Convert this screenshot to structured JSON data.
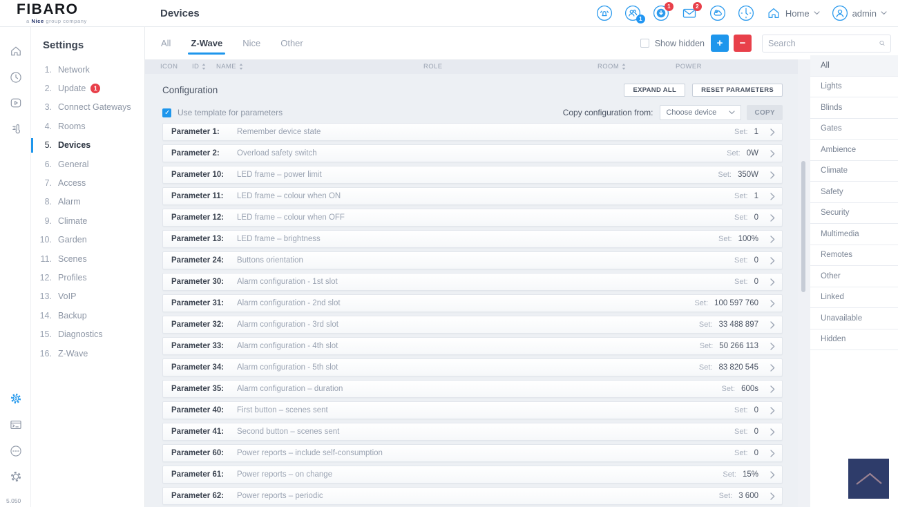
{
  "app": {
    "version": "5.050"
  },
  "colors": {
    "accent_blue": "#1e96ec",
    "danger_red": "#e8404a",
    "navy_button": "#2e3c6a",
    "active_tab_underline": "#1e96ec"
  },
  "logo": {
    "brand": "FIBARO",
    "tagline_prefix": "a ",
    "tagline_brand": "Nice",
    "tagline_suffix": " group company"
  },
  "header": {
    "title": "Devices",
    "notifications": {
      "users_badge": "1",
      "update_badge": "1",
      "messages_badge": "2"
    },
    "home": {
      "label": "Home"
    },
    "user": {
      "label": "admin"
    }
  },
  "sidebar": {
    "title": "Settings",
    "items": [
      {
        "num": "1.",
        "label": "Network"
      },
      {
        "num": "2.",
        "label": "Update",
        "badge": "1"
      },
      {
        "num": "3.",
        "label": "Connect Gateways"
      },
      {
        "num": "4.",
        "label": "Rooms"
      },
      {
        "num": "5.",
        "label": "Devices",
        "active": true
      },
      {
        "num": "6.",
        "label": "General"
      },
      {
        "num": "7.",
        "label": "Access"
      },
      {
        "num": "8.",
        "label": "Alarm"
      },
      {
        "num": "9.",
        "label": "Climate"
      },
      {
        "num": "10.",
        "label": "Garden"
      },
      {
        "num": "11.",
        "label": "Scenes"
      },
      {
        "num": "12.",
        "label": "Profiles"
      },
      {
        "num": "13.",
        "label": "VoIP"
      },
      {
        "num": "14.",
        "label": "Backup"
      },
      {
        "num": "15.",
        "label": "Diagnostics"
      },
      {
        "num": "16.",
        "label": "Z-Wave"
      }
    ]
  },
  "tabs": [
    {
      "label": "All"
    },
    {
      "label": "Z-Wave",
      "active": true
    },
    {
      "label": "Nice"
    },
    {
      "label": "Other"
    }
  ],
  "toolbar": {
    "show_hidden_label": "Show hidden",
    "add_label": "+",
    "remove_label": "−",
    "search_placeholder": "Search"
  },
  "table_header": [
    {
      "label": "ICON"
    },
    {
      "label": "ID",
      "sortable": true
    },
    {
      "label": "NAME",
      "sortable": true
    },
    {
      "label": "ROLE"
    },
    {
      "label": "ROOM",
      "sortable": true
    },
    {
      "label": "POWER"
    }
  ],
  "configuration": {
    "title": "Configuration",
    "expand_all_label": "EXPAND ALL",
    "reset_label": "RESET PARAMETERS",
    "use_template_label": "Use template for parameters",
    "copy_from_label": "Copy configuration from:",
    "choose_device_label": "Choose device",
    "copy_label": "COPY",
    "set_label": "Set:",
    "parameters": [
      {
        "name": "Parameter 1:",
        "description": "Remember device state",
        "value": "1"
      },
      {
        "name": "Parameter 2:",
        "description": "Overload safety switch",
        "value": "0W"
      },
      {
        "name": "Parameter 10:",
        "description": "LED frame – power limit",
        "value": "350W"
      },
      {
        "name": "Parameter 11:",
        "description": "LED frame – colour when ON",
        "value": "1"
      },
      {
        "name": "Parameter 12:",
        "description": "LED frame – colour when OFF",
        "value": "0"
      },
      {
        "name": "Parameter 13:",
        "description": "LED frame – brightness",
        "value": "100%"
      },
      {
        "name": "Parameter 24:",
        "description": "Buttons orientation",
        "value": "0"
      },
      {
        "name": "Parameter 30:",
        "description": "Alarm configuration - 1st slot",
        "value": "0"
      },
      {
        "name": "Parameter 31:",
        "description": "Alarm configuration - 2nd slot",
        "value": "100 597 760"
      },
      {
        "name": "Parameter 32:",
        "description": "Alarm configuration - 3rd slot",
        "value": "33 488 897"
      },
      {
        "name": "Parameter 33:",
        "description": "Alarm configuration - 4th slot",
        "value": "50 266 113"
      },
      {
        "name": "Parameter 34:",
        "description": "Alarm configuration - 5th slot",
        "value": "83 820 545"
      },
      {
        "name": "Parameter 35:",
        "description": "Alarm configuration – duration",
        "value": "600s"
      },
      {
        "name": "Parameter 40:",
        "description": "First button – scenes sent",
        "value": "0"
      },
      {
        "name": "Parameter 41:",
        "description": "Second button – scenes sent",
        "value": "0"
      },
      {
        "name": "Parameter 60:",
        "description": "Power reports – include self-consumption",
        "value": "0"
      },
      {
        "name": "Parameter 61:",
        "description": "Power reports – on change",
        "value": "15%"
      },
      {
        "name": "Parameter 62:",
        "description": "Power reports – periodic",
        "value": "3 600"
      }
    ]
  },
  "right_sidebar": {
    "items": [
      {
        "label": "All",
        "active": true
      },
      {
        "label": "Lights"
      },
      {
        "label": "Blinds"
      },
      {
        "label": "Gates"
      },
      {
        "label": "Ambience"
      },
      {
        "label": "Climate"
      },
      {
        "label": "Safety"
      },
      {
        "label": "Security"
      },
      {
        "label": "Multimedia"
      },
      {
        "label": "Remotes"
      },
      {
        "label": "Other"
      },
      {
        "label": "Linked"
      },
      {
        "label": "Unavailable"
      },
      {
        "label": "Hidden"
      }
    ]
  }
}
